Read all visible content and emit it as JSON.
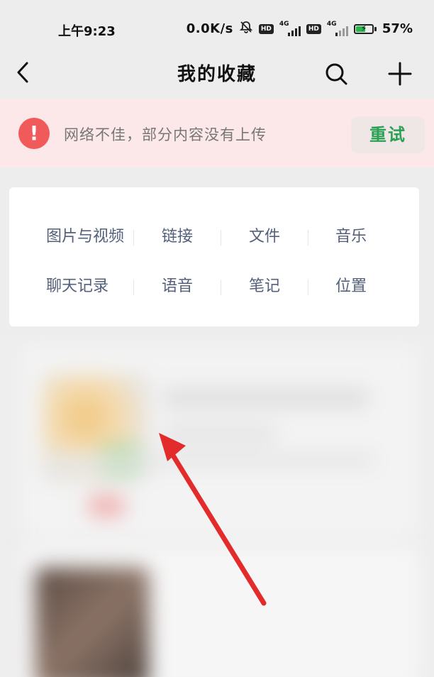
{
  "status_bar": {
    "time": "上午9:23",
    "net_speed": "0.0K/s",
    "hd_badge": "HD",
    "signal_label": "4G",
    "battery_percent": "57%"
  },
  "nav": {
    "title": "我的收藏"
  },
  "alert": {
    "message": "网络不佳，部分内容没有上传",
    "icon_glyph": "!",
    "retry_label": "重试"
  },
  "categories": {
    "row1": [
      "图片与视频",
      "链接",
      "文件",
      "音乐"
    ],
    "row2": [
      "聊天记录",
      "语音",
      "笔记",
      "位置"
    ]
  },
  "colors": {
    "accent_green": "#2aa052",
    "alert_red": "#f05a5a",
    "banner_bg": "#fce8e8",
    "annotation_arrow": "#e32b2b"
  }
}
